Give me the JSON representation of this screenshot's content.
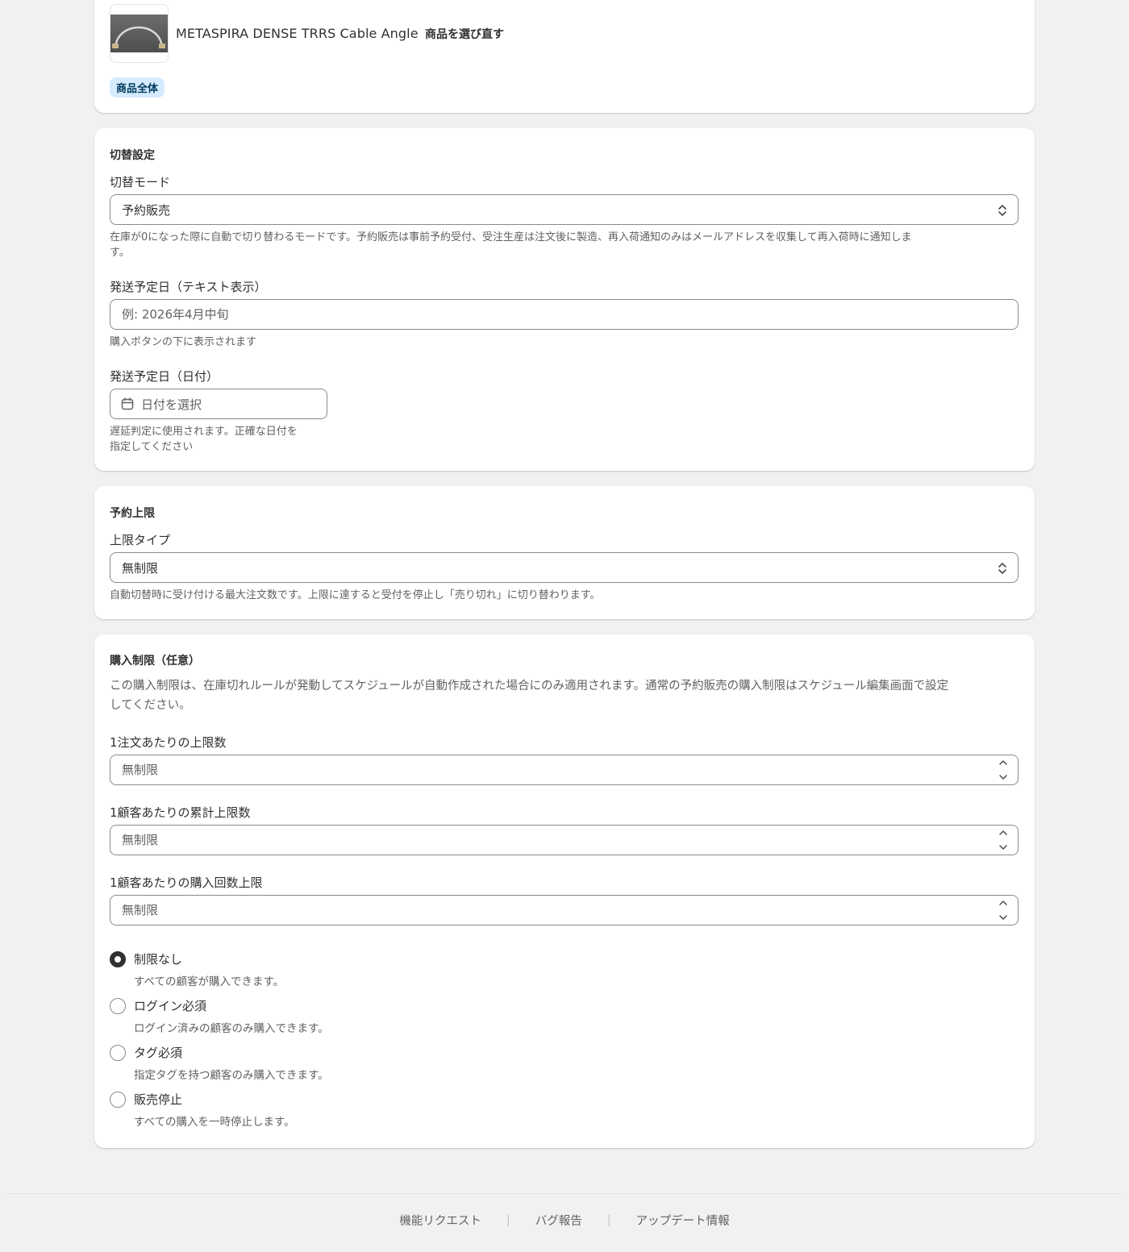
{
  "product": {
    "title": "METASPIRA DENSE TRRS Cable Angle",
    "reselect_label": "商品を選び直す",
    "scope_badge": "商品全体"
  },
  "switch_settings": {
    "section_title": "切替設定",
    "mode_label": "切替モード",
    "mode_value": "予約販売",
    "mode_help_line1": "在庫が0になった際に自動で切り替わるモードです。予約販売は事前予約受付、受注生産は注文後に製造、再入荷通知のみはメールアドレスを収集して再入荷時に通知しま",
    "mode_help_line2": "す。",
    "ship_text_label": "発送予定日（テキスト表示）",
    "ship_text_placeholder": "例: 2026年4月中旬",
    "ship_text_help": "購入ボタンの下に表示されます",
    "ship_date_label": "発送予定日（日付）",
    "ship_date_placeholder": "日付を選択",
    "ship_date_help_line1": "遅延判定に使用されます。正確な日付を",
    "ship_date_help_line2": "指定してください"
  },
  "reservation_limit": {
    "section_title": "予約上限",
    "type_label": "上限タイプ",
    "type_value": "無制限",
    "type_help": "自動切替時に受け付ける最大注文数です。上限に達すると受付を停止し「売り切れ」に切り替わります。"
  },
  "purchase_limit": {
    "section_title": "購入制限（任意）",
    "description_line1": "この購入制限は、在庫切れルールが発動してスケジュールが自動作成された場合にのみ適用されます。通常の予約販売の購入制限はスケジュール編集画面で設定",
    "description_line2": "してください。",
    "per_order_label": "1注文あたりの上限数",
    "per_order_placeholder": "無制限",
    "per_customer_label": "1顧客あたりの累計上限数",
    "per_customer_placeholder": "無制限",
    "purchase_count_label": "1顧客あたりの購入回数上限",
    "purchase_count_placeholder": "無制限",
    "options": [
      {
        "label": "制限なし",
        "help": "すべての顧客が購入できます。",
        "checked": true
      },
      {
        "label": "ログイン必須",
        "help": "ログイン済みの顧客のみ購入できます。",
        "checked": false
      },
      {
        "label": "タグ必須",
        "help": "指定タグを持つ顧客のみ購入できます。",
        "checked": false
      },
      {
        "label": "販売停止",
        "help": "すべての購入を一時停止します。",
        "checked": false
      }
    ]
  },
  "footer": {
    "feature_request": "機能リクエスト",
    "bug_report": "バグ報告",
    "updates": "アップデート情報",
    "separator": "|"
  }
}
